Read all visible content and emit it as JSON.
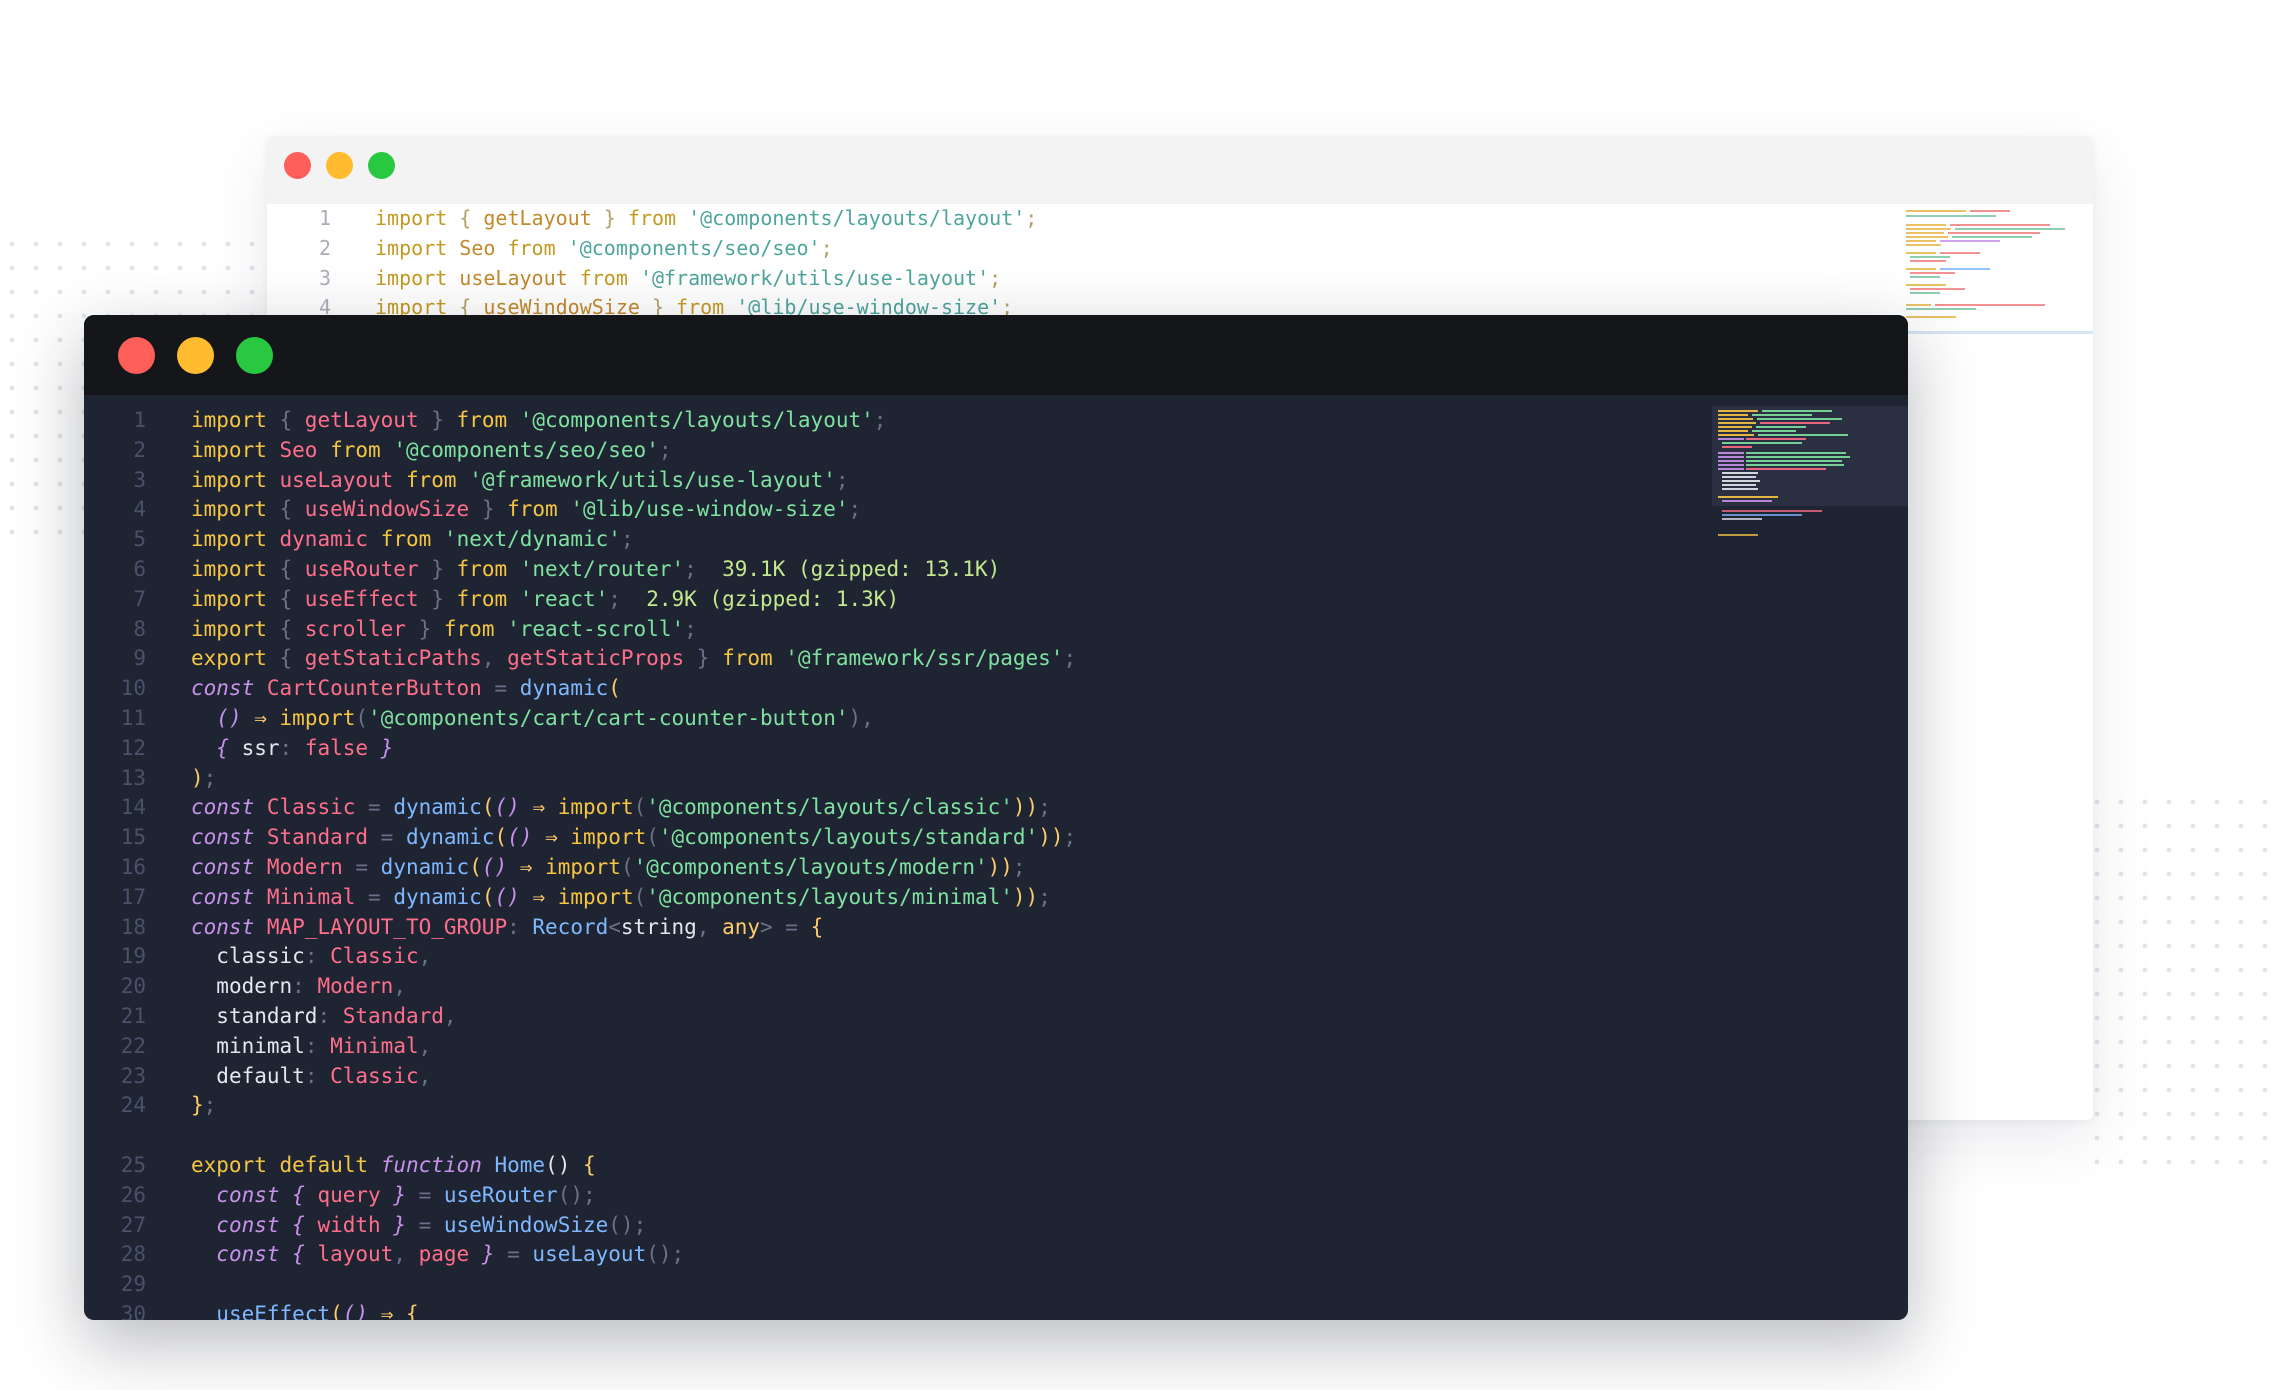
{
  "background_window": {
    "lines": [
      {
        "n": "1",
        "tokens": [
          [
            "import",
            "bk"
          ],
          [
            " { ",
            "bp"
          ],
          [
            "getLayout",
            "bi"
          ],
          [
            " } ",
            "bp"
          ],
          [
            "from",
            "bk"
          ],
          [
            " ",
            "bp"
          ],
          [
            "'@components/layouts/layout'",
            "bs"
          ],
          [
            ";",
            "bp"
          ]
        ]
      },
      {
        "n": "2",
        "tokens": [
          [
            "import",
            "bk"
          ],
          [
            " ",
            "bp"
          ],
          [
            "Seo",
            "bi"
          ],
          [
            " ",
            "bp"
          ],
          [
            "from",
            "bk"
          ],
          [
            " ",
            "bp"
          ],
          [
            "'@components/seo/seo'",
            "bs"
          ],
          [
            ";",
            "bp"
          ]
        ]
      },
      {
        "n": "3",
        "tokens": [
          [
            "import",
            "bk"
          ],
          [
            " ",
            "bp"
          ],
          [
            "useLayout",
            "bi"
          ],
          [
            " ",
            "bp"
          ],
          [
            "from",
            "bk"
          ],
          [
            " ",
            "bp"
          ],
          [
            "'@framework/utils/use-layout'",
            "bs"
          ],
          [
            ";",
            "bp"
          ]
        ]
      },
      {
        "n": "4",
        "tokens": [
          [
            "import",
            "bk"
          ],
          [
            " { ",
            "bp"
          ],
          [
            "useWindowSize",
            "bi"
          ],
          [
            " } ",
            "bp"
          ],
          [
            "from",
            "bk"
          ],
          [
            " ",
            "bp"
          ],
          [
            "'@lib/use-window-size'",
            "bs"
          ],
          [
            ";",
            "bp"
          ]
        ]
      }
    ]
  },
  "editor": {
    "lines": [
      {
        "n": "1",
        "tokens": [
          [
            "import",
            "k"
          ],
          [
            " { ",
            "p"
          ],
          [
            "getLayout",
            "v"
          ],
          [
            " } ",
            "p"
          ],
          [
            "from",
            "k"
          ],
          [
            " ",
            "p"
          ],
          [
            "'@components/layouts/layout'",
            "s"
          ],
          [
            ";",
            "p"
          ]
        ]
      },
      {
        "n": "2",
        "tokens": [
          [
            "import",
            "k"
          ],
          [
            " ",
            "p"
          ],
          [
            "Seo",
            "v"
          ],
          [
            " ",
            "p"
          ],
          [
            "from",
            "k"
          ],
          [
            " ",
            "p"
          ],
          [
            "'@components/seo/seo'",
            "s"
          ],
          [
            ";",
            "p"
          ]
        ]
      },
      {
        "n": "3",
        "tokens": [
          [
            "import",
            "k"
          ],
          [
            " ",
            "p"
          ],
          [
            "useLayout",
            "v"
          ],
          [
            " ",
            "p"
          ],
          [
            "from",
            "k"
          ],
          [
            " ",
            "p"
          ],
          [
            "'@framework/utils/use-layout'",
            "s"
          ],
          [
            ";",
            "p"
          ]
        ]
      },
      {
        "n": "4",
        "tokens": [
          [
            "import",
            "k"
          ],
          [
            " { ",
            "p"
          ],
          [
            "useWindowSize",
            "v"
          ],
          [
            " } ",
            "p"
          ],
          [
            "from",
            "k"
          ],
          [
            " ",
            "p"
          ],
          [
            "'@lib/use-window-size'",
            "s"
          ],
          [
            ";",
            "p"
          ]
        ]
      },
      {
        "n": "5",
        "tokens": [
          [
            "import",
            "k"
          ],
          [
            " ",
            "p"
          ],
          [
            "dynamic",
            "v"
          ],
          [
            " ",
            "p"
          ],
          [
            "from",
            "k"
          ],
          [
            " ",
            "p"
          ],
          [
            "'next/dynamic'",
            "s"
          ],
          [
            ";",
            "p"
          ]
        ]
      },
      {
        "n": "6",
        "tokens": [
          [
            "import",
            "k"
          ],
          [
            " { ",
            "p"
          ],
          [
            "useRouter",
            "v"
          ],
          [
            " } ",
            "p"
          ],
          [
            "from",
            "k"
          ],
          [
            " ",
            "p"
          ],
          [
            "'next/router'",
            "s"
          ],
          [
            ";",
            "p"
          ],
          [
            "  39.1K (gzipped: 13.1K)",
            "t"
          ]
        ]
      },
      {
        "n": "7",
        "tokens": [
          [
            "import",
            "k"
          ],
          [
            " { ",
            "p"
          ],
          [
            "useEffect",
            "v"
          ],
          [
            " } ",
            "p"
          ],
          [
            "from",
            "k"
          ],
          [
            " ",
            "p"
          ],
          [
            "'react'",
            "s"
          ],
          [
            ";",
            "p"
          ],
          [
            "  2.9K (gzipped: 1.3K)",
            "t"
          ]
        ]
      },
      {
        "n": "8",
        "tokens": [
          [
            "import",
            "k"
          ],
          [
            " { ",
            "p"
          ],
          [
            "scroller",
            "v"
          ],
          [
            " } ",
            "p"
          ],
          [
            "from",
            "k"
          ],
          [
            " ",
            "p"
          ],
          [
            "'react-scroll'",
            "s"
          ],
          [
            ";",
            "p"
          ]
        ]
      },
      {
        "n": "9",
        "tokens": [
          [
            "export",
            "k"
          ],
          [
            " { ",
            "p"
          ],
          [
            "getStaticPaths",
            "v"
          ],
          [
            ", ",
            "p"
          ],
          [
            "getStaticProps",
            "v"
          ],
          [
            " } ",
            "p"
          ],
          [
            "from",
            "k"
          ],
          [
            " ",
            "p"
          ],
          [
            "'@framework/ssr/pages'",
            "s"
          ],
          [
            ";",
            "p"
          ]
        ]
      },
      {
        "n": "10",
        "tokens": [
          [
            "const",
            "c"
          ],
          [
            " ",
            "p"
          ],
          [
            "CartCounterButton",
            "v"
          ],
          [
            " = ",
            "p"
          ],
          [
            "dynamic",
            "f"
          ],
          [
            "(",
            "o"
          ]
        ]
      },
      {
        "n": "11",
        "tokens": [
          [
            "  ",
            "p"
          ],
          [
            "()",
            "c"
          ],
          [
            " ⇒ ",
            "o"
          ],
          [
            "import",
            "k"
          ],
          [
            "(",
            "p"
          ],
          [
            "'@components/cart/cart-counter-button'",
            "s"
          ],
          [
            "),",
            "p"
          ]
        ]
      },
      {
        "n": "12",
        "tokens": [
          [
            "  ",
            "p"
          ],
          [
            "{",
            "c"
          ],
          [
            " ",
            "p"
          ],
          [
            "ssr",
            "pl"
          ],
          [
            ": ",
            "p"
          ],
          [
            "false",
            "b"
          ],
          [
            " }",
            "c"
          ]
        ]
      },
      {
        "n": "13",
        "tokens": [
          [
            ")",
            "o"
          ],
          [
            ";",
            "p"
          ]
        ]
      },
      {
        "n": "14",
        "tokens": [
          [
            "const",
            "c"
          ],
          [
            " ",
            "p"
          ],
          [
            "Classic",
            "v"
          ],
          [
            " = ",
            "p"
          ],
          [
            "dynamic",
            "f"
          ],
          [
            "(",
            "o"
          ],
          [
            "()",
            "c"
          ],
          [
            " ⇒ ",
            "o"
          ],
          [
            "import",
            "k"
          ],
          [
            "(",
            "p"
          ],
          [
            "'@components/layouts/classic'",
            "s"
          ],
          [
            "))",
            "o"
          ],
          [
            ";",
            "p"
          ]
        ]
      },
      {
        "n": "15",
        "tokens": [
          [
            "const",
            "c"
          ],
          [
            " ",
            "p"
          ],
          [
            "Standard",
            "v"
          ],
          [
            " = ",
            "p"
          ],
          [
            "dynamic",
            "f"
          ],
          [
            "(",
            "o"
          ],
          [
            "()",
            "c"
          ],
          [
            " ⇒ ",
            "o"
          ],
          [
            "import",
            "k"
          ],
          [
            "(",
            "p"
          ],
          [
            "'@components/layouts/standard'",
            "s"
          ],
          [
            "))",
            "o"
          ],
          [
            ";",
            "p"
          ]
        ]
      },
      {
        "n": "16",
        "tokens": [
          [
            "const",
            "c"
          ],
          [
            " ",
            "p"
          ],
          [
            "Modern",
            "v"
          ],
          [
            " = ",
            "p"
          ],
          [
            "dynamic",
            "f"
          ],
          [
            "(",
            "o"
          ],
          [
            "()",
            "c"
          ],
          [
            " ⇒ ",
            "o"
          ],
          [
            "import",
            "k"
          ],
          [
            "(",
            "p"
          ],
          [
            "'@components/layouts/modern'",
            "s"
          ],
          [
            "))",
            "o"
          ],
          [
            ";",
            "p"
          ]
        ]
      },
      {
        "n": "17",
        "tokens": [
          [
            "const",
            "c"
          ],
          [
            " ",
            "p"
          ],
          [
            "Minimal",
            "v"
          ],
          [
            " = ",
            "p"
          ],
          [
            "dynamic",
            "f"
          ],
          [
            "(",
            "o"
          ],
          [
            "()",
            "c"
          ],
          [
            " ⇒ ",
            "o"
          ],
          [
            "import",
            "k"
          ],
          [
            "(",
            "p"
          ],
          [
            "'@components/layouts/minimal'",
            "s"
          ],
          [
            "))",
            "o"
          ],
          [
            ";",
            "p"
          ]
        ]
      },
      {
        "n": "18",
        "tokens": [
          [
            "const",
            "c"
          ],
          [
            " ",
            "p"
          ],
          [
            "MAP_LAYOUT_TO_GROUP",
            "v"
          ],
          [
            ": ",
            "p"
          ],
          [
            "Record",
            "f"
          ],
          [
            "<",
            "p"
          ],
          [
            "string",
            "pl"
          ],
          [
            ", ",
            "p"
          ],
          [
            "any",
            "o"
          ],
          [
            "> = ",
            "p"
          ],
          [
            "{",
            "o"
          ]
        ]
      },
      {
        "n": "19",
        "tokens": [
          [
            "  ",
            "p"
          ],
          [
            "classic",
            "pl"
          ],
          [
            ": ",
            "p"
          ],
          [
            "Classic",
            "v"
          ],
          [
            ",",
            "p"
          ]
        ]
      },
      {
        "n": "20",
        "tokens": [
          [
            "  ",
            "p"
          ],
          [
            "modern",
            "pl"
          ],
          [
            ": ",
            "p"
          ],
          [
            "Modern",
            "v"
          ],
          [
            ",",
            "p"
          ]
        ]
      },
      {
        "n": "21",
        "tokens": [
          [
            "  ",
            "p"
          ],
          [
            "standard",
            "pl"
          ],
          [
            ": ",
            "p"
          ],
          [
            "Standard",
            "v"
          ],
          [
            ",",
            "p"
          ]
        ]
      },
      {
        "n": "22",
        "tokens": [
          [
            "  ",
            "p"
          ],
          [
            "minimal",
            "pl"
          ],
          [
            ": ",
            "p"
          ],
          [
            "Minimal",
            "v"
          ],
          [
            ",",
            "p"
          ]
        ]
      },
      {
        "n": "23",
        "tokens": [
          [
            "  ",
            "p"
          ],
          [
            "default",
            "pl"
          ],
          [
            ": ",
            "p"
          ],
          [
            "Classic",
            "v"
          ],
          [
            ",",
            "p"
          ]
        ]
      },
      {
        "n": "24",
        "tokens": [
          [
            "}",
            "o"
          ],
          [
            ";",
            "p"
          ]
        ]
      },
      {
        "n": "",
        "tokens": []
      },
      {
        "n": "25",
        "tokens": [
          [
            "export",
            "k"
          ],
          [
            " ",
            "p"
          ],
          [
            "default",
            "k"
          ],
          [
            " ",
            "p"
          ],
          [
            "function",
            "c"
          ],
          [
            " ",
            "p"
          ],
          [
            "Home",
            "f"
          ],
          [
            "()",
            "pl"
          ],
          [
            " ",
            "p"
          ],
          [
            "{",
            "o"
          ]
        ]
      },
      {
        "n": "26",
        "tokens": [
          [
            "  ",
            "p"
          ],
          [
            "const",
            "c"
          ],
          [
            " { ",
            "c"
          ],
          [
            "query",
            "v"
          ],
          [
            " } ",
            "c"
          ],
          [
            "= ",
            "p"
          ],
          [
            "useRouter",
            "f"
          ],
          [
            "()",
            "p"
          ],
          [
            ";",
            "p"
          ]
        ]
      },
      {
        "n": "27",
        "tokens": [
          [
            "  ",
            "p"
          ],
          [
            "const",
            "c"
          ],
          [
            " { ",
            "c"
          ],
          [
            "width",
            "v"
          ],
          [
            " } ",
            "c"
          ],
          [
            "= ",
            "p"
          ],
          [
            "useWindowSize",
            "f"
          ],
          [
            "()",
            "p"
          ],
          [
            ";",
            "p"
          ]
        ]
      },
      {
        "n": "28",
        "tokens": [
          [
            "  ",
            "p"
          ],
          [
            "const",
            "c"
          ],
          [
            " { ",
            "c"
          ],
          [
            "layout",
            "v"
          ],
          [
            ", ",
            "p"
          ],
          [
            "page",
            "v"
          ],
          [
            " } ",
            "c"
          ],
          [
            "= ",
            "p"
          ],
          [
            "useLayout",
            "f"
          ],
          [
            "()",
            "p"
          ],
          [
            ";",
            "p"
          ]
        ]
      },
      {
        "n": "29",
        "tokens": []
      },
      {
        "n": "30",
        "tokens": [
          [
            "  ",
            "p"
          ],
          [
            "useEffect",
            "f"
          ],
          [
            "(",
            "o"
          ],
          [
            "()",
            "c"
          ],
          [
            " ⇒ ",
            "o"
          ],
          [
            "{",
            "o"
          ]
        ]
      }
    ]
  },
  "colors": {
    "close": "#fe5f58",
    "minimize": "#febc2e",
    "maximize": "#28c840",
    "editor_bg": "#1f2433",
    "titlebar_bg": "#151619"
  }
}
